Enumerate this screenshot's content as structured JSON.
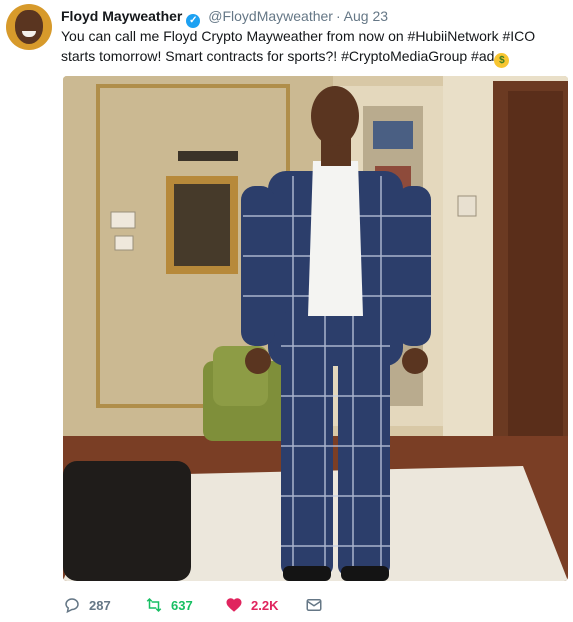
{
  "tweet": {
    "author_name": "Floyd Mayweather",
    "verified_icon": "verified-badge-icon",
    "handle": "@FloydMayweather",
    "separator": "·",
    "date": "Aug 23",
    "text_part1": "You can call me Floyd Crypto Mayweather from now on ",
    "hashtag1": "#HubiiNetwork",
    "text_part2": " ",
    "hashtag2": "#ICO",
    "text_part3": " starts tomorrow! Smart contracts for sports?!  ",
    "hashtag3": "#CryptoMediaGroup",
    "text_part4": " ",
    "hashtag4": "#ad",
    "emoji_icon": "money-mouth-face-icon"
  },
  "actions": {
    "reply_count": "287",
    "retweet_count": "637",
    "like_count": "2.2K",
    "reply_icon": "reply-icon",
    "retweet_icon": "retweet-icon",
    "like_icon": "heart-icon",
    "message_icon": "direct-message-icon"
  },
  "colors": {
    "retweet_active": "#17bf63",
    "like_active": "#e0245e",
    "verified": "#1da1f2",
    "muted": "#657786"
  }
}
